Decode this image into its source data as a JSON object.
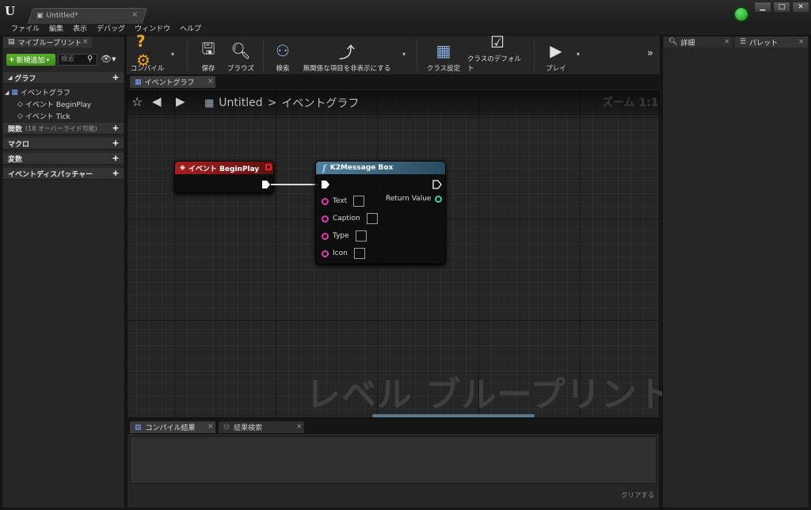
{
  "window": {
    "tab_title": "Untitled*",
    "tab_close": "×",
    "controls": {
      "minimize": "▁",
      "maximize": "□",
      "close": "✕"
    }
  },
  "menu": [
    "ファイル",
    "編集",
    "表示",
    "デバッグ",
    "ウィンドウ",
    "ヘルプ"
  ],
  "left_panel": {
    "tab_label": "マイブループリント",
    "tab_close": "×",
    "add_new_label": "新規追加",
    "search_placeholder": "検索",
    "sections": {
      "graph": "グラフ",
      "event_graph": "イベントグラフ",
      "event_begin_play": "イベント BeginPlay",
      "event_tick": "イベント Tick",
      "functions": "関数",
      "functions_sub": "(18 オーバーライド可能)",
      "macros": "マクロ",
      "variables": "変数",
      "dispatchers": "イベントディスパッチャー"
    },
    "plus": "+"
  },
  "toolbar": {
    "compile": "コンパイル",
    "save": "保存",
    "browse": "ブラウズ",
    "find": "検索",
    "hide_unrelated": "無関係な項目を非表示にする",
    "class_settings": "クラス設定",
    "class_defaults": "クラスのデフォルト",
    "play": "プレイ",
    "overflow": "»"
  },
  "graph": {
    "tab_label": "イベントグラフ",
    "tab_close": "×",
    "breadcrumb_root": "Untitled",
    "breadcrumb_sep": ">",
    "breadcrumb_leaf": "イベントグラフ",
    "zoom": "ズーム 1:1",
    "watermark": "レベル ブループリント",
    "nodes": {
      "begin_play_title": "イベント BeginPlay",
      "message_title": "K2Message Box",
      "pins": [
        "Text",
        "Caption",
        "Type",
        "Icon"
      ],
      "return_value": "Return Value"
    }
  },
  "bottom_panel": {
    "tab_compile_results": "コンパイル結果",
    "tab_find_results": "結果検索",
    "tab_close": "×",
    "clear": "クリアする"
  },
  "right_panel": {
    "tab_details": "詳細",
    "tab_palette": "パレット",
    "tab_close": "×"
  }
}
